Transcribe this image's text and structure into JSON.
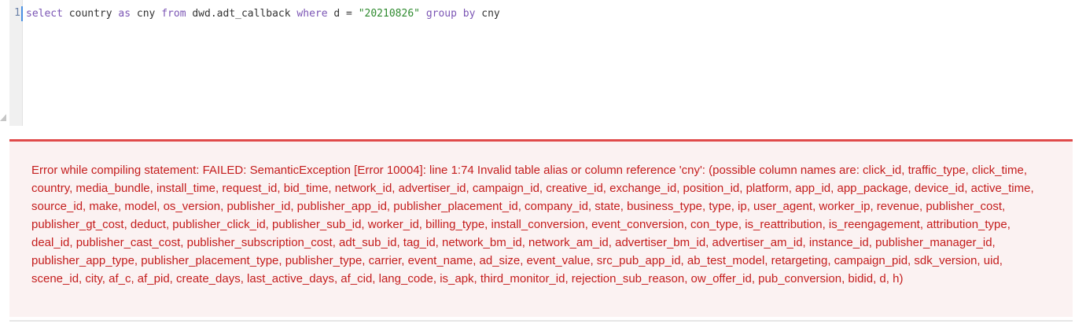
{
  "editor": {
    "line_number": "1",
    "tokens": {
      "t1": "select",
      "t2": " country ",
      "t3": "as",
      "t4": " cny ",
      "t5": "from",
      "t6": " dwd.adt_callback ",
      "t7": "where",
      "t8": " d = ",
      "t9": "\"20210826\"",
      "t10": " ",
      "t11": "group",
      "t12": " ",
      "t13": "by",
      "t14": " cny"
    }
  },
  "error": {
    "message": "Error while compiling statement: FAILED: SemanticException [Error 10004]: line 1:74 Invalid table alias or column reference 'cny': (possible column names are: click_id, traffic_type, click_time, country, media_bundle, install_time, request_id, bid_time, network_id, advertiser_id, campaign_id, creative_id, exchange_id, position_id, platform, app_id, app_package, device_id, active_time, source_id, make, model, os_version, publisher_id, publisher_app_id, publisher_placement_id, company_id, state, business_type, type, ip, user_agent, worker_ip, revenue, publisher_cost, publisher_gt_cost, deduct, publisher_click_id, publisher_sub_id, worker_id, billing_type, install_conversion, event_conversion, con_type, is_reattribution, is_reengagement, attribution_type, deal_id, publisher_cast_cost, publisher_subscription_cost, adt_sub_id, tag_id, network_bm_id, network_am_id, advertiser_bm_id, advertiser_am_id, instance_id, publisher_manager_id, publisher_app_type, publisher_placement_type, publisher_type, carrier, event_name, ad_size, event_value, src_pub_app_id, ab_test_model, retargeting, campaign_pid, sdk_version, uid, scene_id, city, af_c, af_pid, create_days, last_active_days, af_cid, lang_code, is_apk, third_monitor_id, rejection_sub_reason, ow_offer_id, pub_conversion, bidid, d, h)"
  },
  "colors": {
    "keyword": "#7b55b4",
    "string": "#2e8a2e",
    "error_text": "#c41d1d",
    "error_border": "#e04a4a",
    "error_background": "#fbf2f2"
  }
}
